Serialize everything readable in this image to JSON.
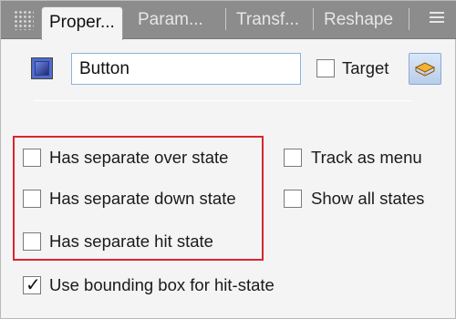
{
  "tabs": [
    {
      "label": "Proper...",
      "active": true
    },
    {
      "label": "Param...",
      "active": false
    },
    {
      "label": "Transf...",
      "active": false
    },
    {
      "label": "Reshape",
      "active": false
    }
  ],
  "header": {
    "name_value": "Button",
    "target_label": "Target",
    "target_checked": false
  },
  "options": {
    "over_state_label": "Has separate over state",
    "down_state_label": "Has separate down state",
    "hit_state_label": "Has separate hit state",
    "track_menu_label": "Track as menu",
    "show_all_label": "Show all states",
    "bounding_box_label": "Use bounding box for hit-state"
  },
  "checked": {
    "over_state": false,
    "down_state": false,
    "hit_state": false,
    "track_menu": false,
    "show_all": false,
    "bounding_box": true
  },
  "colors": {
    "highlight": "#d9272e",
    "tab_strip": "#8c8c8c",
    "input_border": "#8ab4e0"
  },
  "icons": [
    "grip-icon",
    "tab-menu-icon",
    "color-swatch-icon",
    "target-select-icon"
  ]
}
